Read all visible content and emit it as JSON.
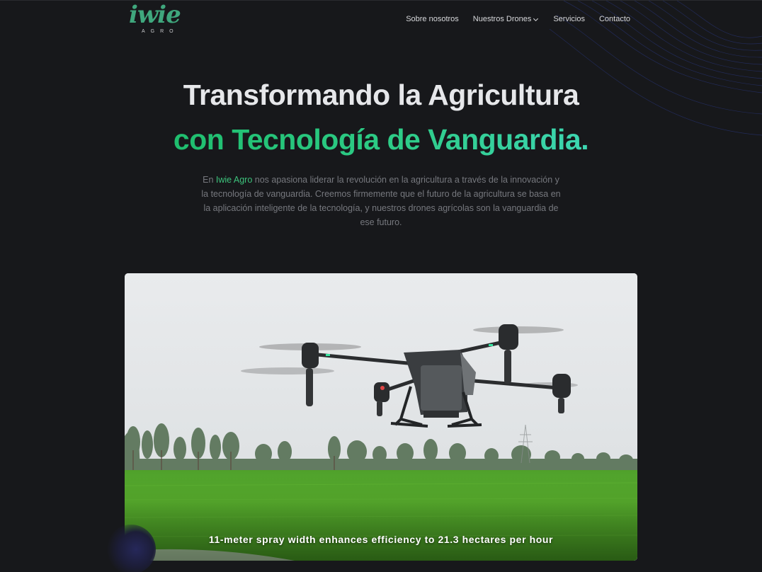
{
  "brand": {
    "logo_text": "iwie",
    "logo_subtext": "AGRO",
    "logo_color": "#3fa77d"
  },
  "nav": {
    "items": [
      {
        "label": "Sobre nosotros",
        "has_dropdown": false
      },
      {
        "label": "Nuestros Drones",
        "has_dropdown": true
      },
      {
        "label": "Servicios",
        "has_dropdown": false
      },
      {
        "label": "Contacto",
        "has_dropdown": false
      }
    ]
  },
  "hero": {
    "title_line1": "Transformando la Agricultura",
    "title_line2": "con Tecnología de Vanguardia.",
    "desc_prefix": "En ",
    "desc_brand": "Iwie Agro",
    "desc_rest": " nos apasiona liderar la revolución en la agricultura a través de la innovación y la tecnología de vanguardia. Creemos firmemente que el futuro de la agricultura se basa en la aplicación inteligente de la tecnología, y nuestros drones agrícolas son la vanguardia de ese futuro.",
    "accent_color": "#2ecc88"
  },
  "media": {
    "caption": "11-meter spray width enhances efficiency to 21.3 hectares per hour"
  },
  "icons": {
    "dropdown": "chevron-down-icon",
    "drone": "drone-image"
  }
}
